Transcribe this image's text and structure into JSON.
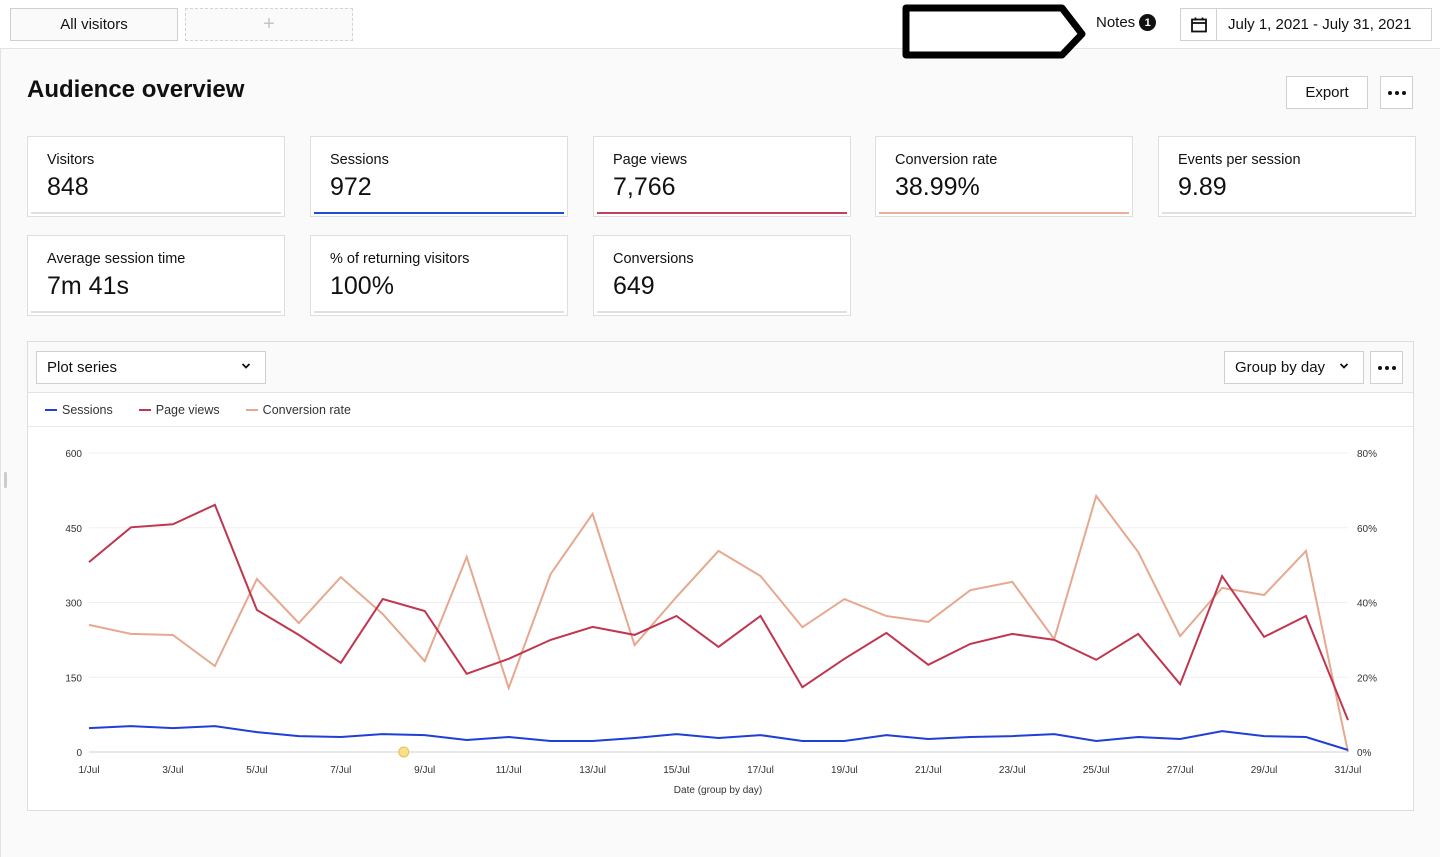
{
  "topbar": {
    "segment_label": "All visitors",
    "add_segment_label": "+",
    "notes_label": "Notes",
    "notes_count": "1",
    "date_range": "July 1, 2021 - July 31, 2021"
  },
  "page": {
    "title": "Audience overview",
    "export_label": "Export"
  },
  "cards": [
    {
      "label": "Visitors",
      "value": "848",
      "accent": "#e0e0e0"
    },
    {
      "label": "Sessions",
      "value": "972",
      "accent": "#1f4fd1"
    },
    {
      "label": "Page views",
      "value": "7,766",
      "accent": "#c0425a"
    },
    {
      "label": "Conversion rate",
      "value": "38.99%",
      "accent": "#e8b09a"
    },
    {
      "label": "Events per session",
      "value": "9.89",
      "accent": "#e0e0e0"
    },
    {
      "label": "Average session time",
      "value": "7m 41s",
      "accent": "#e0e0e0"
    },
    {
      "label": "% of returning visitors",
      "value": "100%",
      "accent": "#e0e0e0"
    },
    {
      "label": "Conversions",
      "value": "649",
      "accent": "#e0e0e0"
    }
  ],
  "chart_panel": {
    "plot_series_label": "Plot series",
    "group_by_label": "Group by day"
  },
  "chart_data": {
    "type": "line",
    "title": "",
    "xlabel": "Date (group by day)",
    "ylabel": "",
    "x": [
      "1/Jul",
      "2/Jul",
      "3/Jul",
      "4/Jul",
      "5/Jul",
      "6/Jul",
      "7/Jul",
      "8/Jul",
      "9/Jul",
      "10/Jul",
      "11/Jul",
      "12/Jul",
      "13/Jul",
      "14/Jul",
      "15/Jul",
      "16/Jul",
      "17/Jul",
      "18/Jul",
      "19/Jul",
      "20/Jul",
      "21/Jul",
      "22/Jul",
      "23/Jul",
      "24/Jul",
      "25/Jul",
      "26/Jul",
      "27/Jul",
      "28/Jul",
      "29/Jul",
      "30/Jul",
      "31/Jul"
    ],
    "x_tick_labels": [
      "1/Jul",
      "3/Jul",
      "5/Jul",
      "7/Jul",
      "9/Jul",
      "11/Jul",
      "13/Jul",
      "15/Jul",
      "17/Jul",
      "19/Jul",
      "21/Jul",
      "23/Jul",
      "25/Jul",
      "27/Jul",
      "29/Jul",
      "31/Jul"
    ],
    "y_left": {
      "ylim": [
        0,
        600
      ],
      "ticks": [
        "0",
        "150",
        "300",
        "450",
        "600"
      ]
    },
    "y_right": {
      "ylim": [
        0,
        80
      ],
      "ticks": [
        "0%",
        "20%",
        "40%",
        "60%",
        "80%"
      ]
    },
    "grid": true,
    "legend_position": "top-left",
    "annotation_marker": {
      "x": "8/Jul",
      "color": "#f7e08a",
      "meaning": "note"
    },
    "series": [
      {
        "name": "Sessions",
        "axis": "left",
        "color": "#1f3fd6",
        "values": [
          48,
          52,
          48,
          52,
          40,
          32,
          30,
          36,
          34,
          24,
          30,
          22,
          22,
          28,
          36,
          28,
          34,
          22,
          22,
          34,
          26,
          30,
          32,
          36,
          22,
          30,
          26,
          42,
          32,
          30,
          4
        ]
      },
      {
        "name": "Page views",
        "axis": "left",
        "color": "#c0354f",
        "values": [
          381,
          451,
          457,
          496,
          285,
          235,
          179,
          307,
          283,
          157,
          187,
          225,
          251,
          235,
          273,
          211,
          273,
          130,
          187,
          239,
          175,
          217,
          237,
          225,
          185,
          237,
          136,
          353,
          231,
          273,
          64
        ]
      },
      {
        "name": "Conversion rate",
        "axis": "right",
        "color": "#e6a88f",
        "values": [
          34.0,
          31.6,
          31.3,
          23.0,
          46.3,
          34.5,
          46.8,
          36.9,
          24.3,
          52.2,
          17.1,
          47.6,
          63.7,
          28.6,
          41.5,
          53.8,
          47.1,
          33.4,
          40.9,
          36.4,
          34.8,
          43.3,
          45.5,
          30.2,
          68.5,
          53.5,
          31.0,
          43.9,
          42.0,
          53.8,
          0
        ]
      }
    ]
  }
}
